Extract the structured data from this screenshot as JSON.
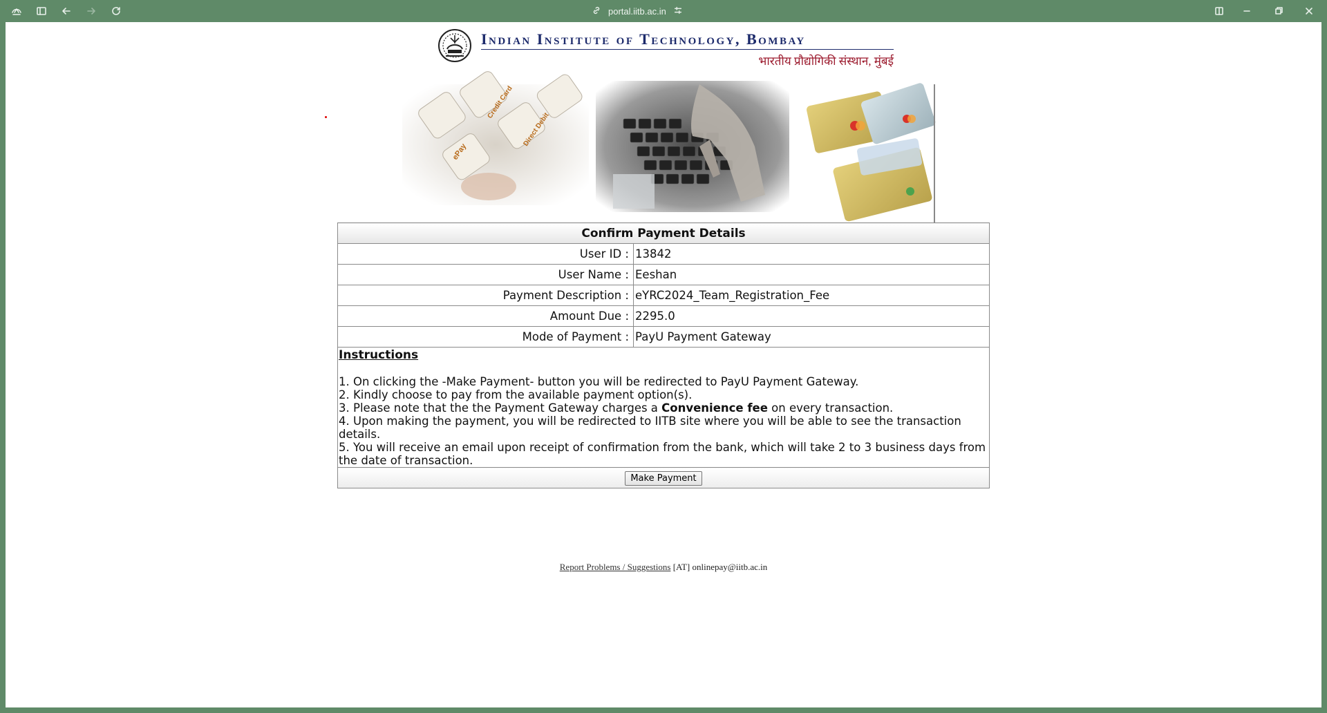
{
  "browser": {
    "url": "portal.iitb.ac.in",
    "icons": [
      "browser-logo-icon",
      "sidebar-toggle-icon",
      "back-icon",
      "forward-icon",
      "reload-icon",
      "link-icon",
      "url-settings-icon",
      "split-view-icon",
      "minimize-icon",
      "restore-icon",
      "close-icon"
    ]
  },
  "header": {
    "institute_name": "Indian Institute of Technology, Bombay",
    "institute_name_hindi": "भारतीय प्रौद्योगिकी संस्थान, मुंबई",
    "banner_key_labels": [
      "ePay",
      "Credit Card",
      "Direct Debit"
    ]
  },
  "payment": {
    "title": "Confirm Payment Details",
    "rows": [
      {
        "label": "User ID :",
        "value": "13842"
      },
      {
        "label": "User Name :",
        "value": "Eeshan"
      },
      {
        "label": "Payment Description :",
        "value": "eYRC2024_Team_Registration_Fee"
      },
      {
        "label": "Amount Due :",
        "value": "2295.0"
      },
      {
        "label": "Mode of Payment :",
        "value": "PayU Payment Gateway"
      }
    ],
    "instructions_title": "Instructions",
    "instructions": {
      "line1": "1. On clicking the -Make Payment- button you will be redirected to PayU Payment Gateway.",
      "line2": "2. Kindly choose to pay from the available payment option(s).",
      "line3_pre": "3. Please note that the the Payment Gateway charges a ",
      "line3_bold": "Convenience fee",
      "line3_post": " on every transaction.",
      "line4": "4. Upon making the payment, you will be redirected to IITB site where you will be able to see the transaction details.",
      "line5": "5. You will receive an email upon receipt of confirmation from the bank, which will take 2 to 3 business days from the date of transaction."
    },
    "button_label": "Make Payment"
  },
  "footer": {
    "link_text": "Report Problems / Suggestions",
    "contact": " [AT] onlinepay@iitb.ac.in"
  },
  "colors": {
    "chrome": "#5f8a68",
    "institute_blue": "#1c2a6b",
    "hindi_red": "#9c1b2e"
  }
}
